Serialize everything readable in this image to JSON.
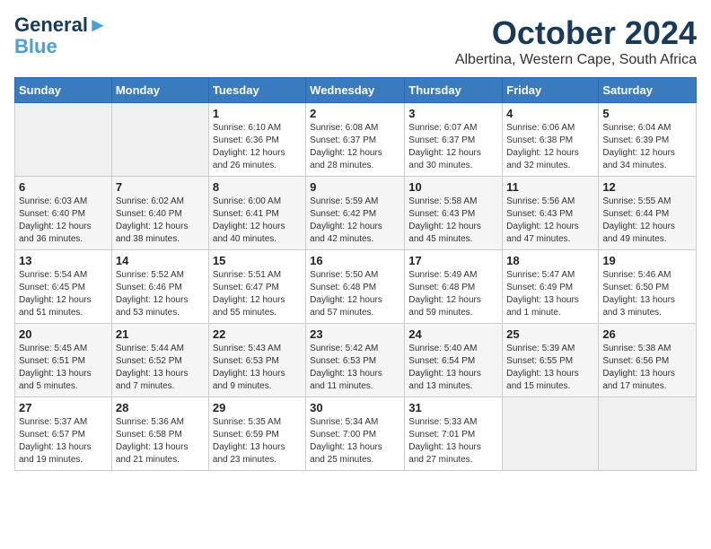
{
  "header": {
    "logo_line1": "General",
    "logo_line2": "Blue",
    "month": "October 2024",
    "location": "Albertina, Western Cape, South Africa"
  },
  "days_of_week": [
    "Sunday",
    "Monday",
    "Tuesday",
    "Wednesday",
    "Thursday",
    "Friday",
    "Saturday"
  ],
  "weeks": [
    [
      {
        "num": "",
        "detail": ""
      },
      {
        "num": "",
        "detail": ""
      },
      {
        "num": "1",
        "detail": "Sunrise: 6:10 AM\nSunset: 6:36 PM\nDaylight: 12 hours\nand 26 minutes."
      },
      {
        "num": "2",
        "detail": "Sunrise: 6:08 AM\nSunset: 6:37 PM\nDaylight: 12 hours\nand 28 minutes."
      },
      {
        "num": "3",
        "detail": "Sunrise: 6:07 AM\nSunset: 6:37 PM\nDaylight: 12 hours\nand 30 minutes."
      },
      {
        "num": "4",
        "detail": "Sunrise: 6:06 AM\nSunset: 6:38 PM\nDaylight: 12 hours\nand 32 minutes."
      },
      {
        "num": "5",
        "detail": "Sunrise: 6:04 AM\nSunset: 6:39 PM\nDaylight: 12 hours\nand 34 minutes."
      }
    ],
    [
      {
        "num": "6",
        "detail": "Sunrise: 6:03 AM\nSunset: 6:40 PM\nDaylight: 12 hours\nand 36 minutes."
      },
      {
        "num": "7",
        "detail": "Sunrise: 6:02 AM\nSunset: 6:40 PM\nDaylight: 12 hours\nand 38 minutes."
      },
      {
        "num": "8",
        "detail": "Sunrise: 6:00 AM\nSunset: 6:41 PM\nDaylight: 12 hours\nand 40 minutes."
      },
      {
        "num": "9",
        "detail": "Sunrise: 5:59 AM\nSunset: 6:42 PM\nDaylight: 12 hours\nand 42 minutes."
      },
      {
        "num": "10",
        "detail": "Sunrise: 5:58 AM\nSunset: 6:43 PM\nDaylight: 12 hours\nand 45 minutes."
      },
      {
        "num": "11",
        "detail": "Sunrise: 5:56 AM\nSunset: 6:43 PM\nDaylight: 12 hours\nand 47 minutes."
      },
      {
        "num": "12",
        "detail": "Sunrise: 5:55 AM\nSunset: 6:44 PM\nDaylight: 12 hours\nand 49 minutes."
      }
    ],
    [
      {
        "num": "13",
        "detail": "Sunrise: 5:54 AM\nSunset: 6:45 PM\nDaylight: 12 hours\nand 51 minutes."
      },
      {
        "num": "14",
        "detail": "Sunrise: 5:52 AM\nSunset: 6:46 PM\nDaylight: 12 hours\nand 53 minutes."
      },
      {
        "num": "15",
        "detail": "Sunrise: 5:51 AM\nSunset: 6:47 PM\nDaylight: 12 hours\nand 55 minutes."
      },
      {
        "num": "16",
        "detail": "Sunrise: 5:50 AM\nSunset: 6:48 PM\nDaylight: 12 hours\nand 57 minutes."
      },
      {
        "num": "17",
        "detail": "Sunrise: 5:49 AM\nSunset: 6:48 PM\nDaylight: 12 hours\nand 59 minutes."
      },
      {
        "num": "18",
        "detail": "Sunrise: 5:47 AM\nSunset: 6:49 PM\nDaylight: 13 hours\nand 1 minute."
      },
      {
        "num": "19",
        "detail": "Sunrise: 5:46 AM\nSunset: 6:50 PM\nDaylight: 13 hours\nand 3 minutes."
      }
    ],
    [
      {
        "num": "20",
        "detail": "Sunrise: 5:45 AM\nSunset: 6:51 PM\nDaylight: 13 hours\nand 5 minutes."
      },
      {
        "num": "21",
        "detail": "Sunrise: 5:44 AM\nSunset: 6:52 PM\nDaylight: 13 hours\nand 7 minutes."
      },
      {
        "num": "22",
        "detail": "Sunrise: 5:43 AM\nSunset: 6:53 PM\nDaylight: 13 hours\nand 9 minutes."
      },
      {
        "num": "23",
        "detail": "Sunrise: 5:42 AM\nSunset: 6:53 PM\nDaylight: 13 hours\nand 11 minutes."
      },
      {
        "num": "24",
        "detail": "Sunrise: 5:40 AM\nSunset: 6:54 PM\nDaylight: 13 hours\nand 13 minutes."
      },
      {
        "num": "25",
        "detail": "Sunrise: 5:39 AM\nSunset: 6:55 PM\nDaylight: 13 hours\nand 15 minutes."
      },
      {
        "num": "26",
        "detail": "Sunrise: 5:38 AM\nSunset: 6:56 PM\nDaylight: 13 hours\nand 17 minutes."
      }
    ],
    [
      {
        "num": "27",
        "detail": "Sunrise: 5:37 AM\nSunset: 6:57 PM\nDaylight: 13 hours\nand 19 minutes."
      },
      {
        "num": "28",
        "detail": "Sunrise: 5:36 AM\nSunset: 6:58 PM\nDaylight: 13 hours\nand 21 minutes."
      },
      {
        "num": "29",
        "detail": "Sunrise: 5:35 AM\nSunset: 6:59 PM\nDaylight: 13 hours\nand 23 minutes."
      },
      {
        "num": "30",
        "detail": "Sunrise: 5:34 AM\nSunset: 7:00 PM\nDaylight: 13 hours\nand 25 minutes."
      },
      {
        "num": "31",
        "detail": "Sunrise: 5:33 AM\nSunset: 7:01 PM\nDaylight: 13 hours\nand 27 minutes."
      },
      {
        "num": "",
        "detail": ""
      },
      {
        "num": "",
        "detail": ""
      }
    ]
  ]
}
